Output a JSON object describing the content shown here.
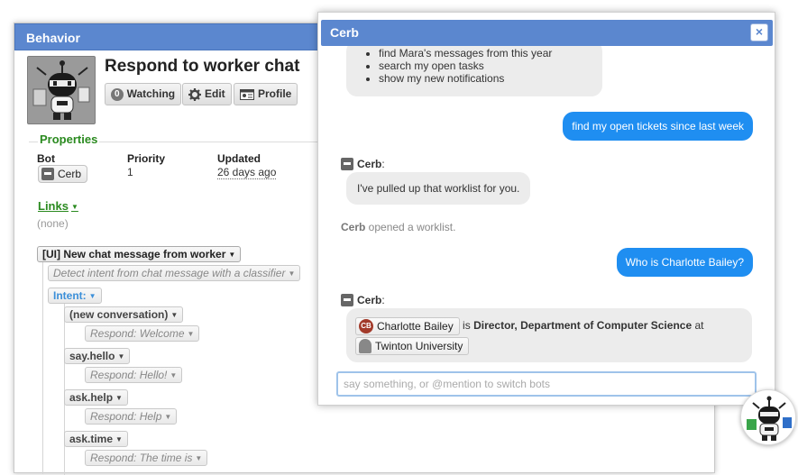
{
  "behavior": {
    "window_title": "Behavior",
    "record_title": "Respond to worker chat",
    "toolbar": {
      "watching_count": "0",
      "watching_label": "Watching",
      "edit_label": "Edit",
      "profile_label": "Profile"
    },
    "properties": {
      "section_label": "Properties",
      "bot_label": "Bot",
      "bot_value": "Cerb",
      "priority_label": "Priority",
      "priority_value": "1",
      "updated_label": "Updated",
      "updated_value": "26 days ago"
    },
    "links": {
      "label": "Links",
      "empty_text": "(none)"
    },
    "tree": {
      "root": "[UI] New chat message from worker",
      "detect": "Detect intent from chat message with a classifier",
      "intent": "Intent:",
      "new_conversation": "(new conversation)",
      "respond_welcome": "Respond: Welcome",
      "say_hello": "say.hello",
      "respond_hello": "Respond: Hello!",
      "ask_help": "ask.help",
      "respond_help": "Respond: Help",
      "ask_time": "ask.time",
      "respond_time": "Respond: The time is"
    }
  },
  "chat": {
    "window_title": "Cerb",
    "close_glyph": "×",
    "suggestions": [
      "find Mara's messages from this year",
      "search my open tasks",
      "show my new notifications"
    ],
    "msg_user_1": "find my open tickets since last week",
    "sender_name": "Cerb",
    "sender_suffix": ":",
    "msg_bot_1": "I've pulled up that worklist for you.",
    "event_actor": "Cerb",
    "event_text": " opened a worklist.",
    "msg_user_2": "Who is Charlotte Bailey?",
    "answer": {
      "person_initials": "CB",
      "person_name": "Charlotte Bailey",
      "is_text": " is ",
      "title": "Director, Department of Computer Science",
      "at_text": " at",
      "org_name": "Twinton University"
    },
    "input_placeholder": "say something, or @mention to switch bots"
  },
  "colors": {
    "titlebar": "#5b87cf",
    "section_green": "#2a8a1f",
    "user_bubble": "#1f8ef1",
    "bot_bubble": "#ececec"
  }
}
